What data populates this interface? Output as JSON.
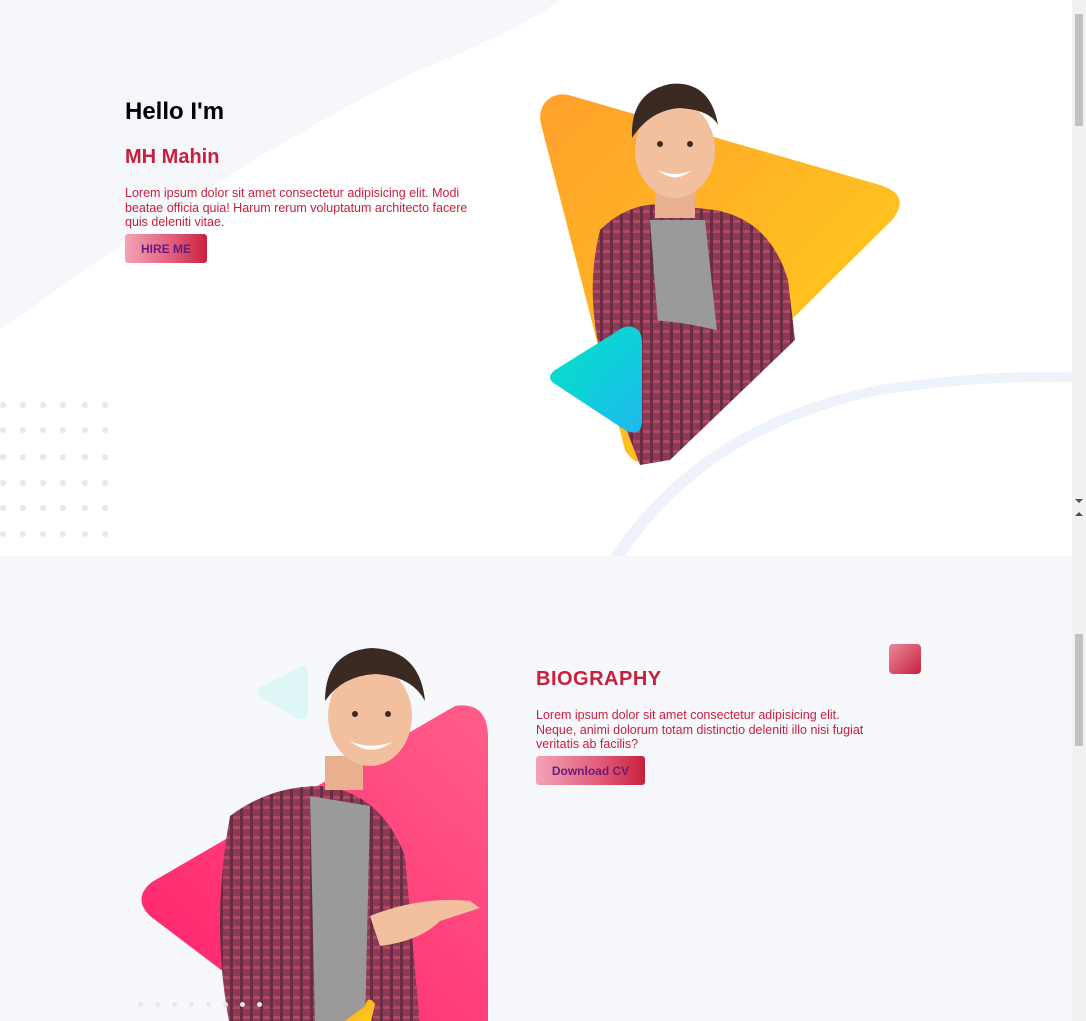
{
  "hero": {
    "greeting": "Hello I'm",
    "name": "MH Mahin",
    "description": "Lorem ipsum dolor sit amet consectetur adipisicing elit. Modi beatae officia quia! Harum rerum voluptatum architecto facere quis deleniti vitae.",
    "hire_button": "HIRE ME"
  },
  "biography": {
    "title": "BIOGRAPHY",
    "description": "Lorem ipsum dolor sit amet consectetur adipisicing elit. Neque, animi dolorum totam distinctio deleniti illo nisi fugiat veritatis ab facilis?",
    "download_button": "Download CV"
  },
  "colors": {
    "accent_red": "#c8203c",
    "button_text": "#6a1b7a",
    "gradient_orange_start": "#ffa02b",
    "gradient_orange_end": "#ffd21a",
    "gradient_teal": "#00e6c3",
    "gradient_pink": "#ff3c7e",
    "about_bg": "#f7f8fc"
  },
  "icons": {
    "hero_person_image": "person-arms-crossed-photo",
    "about_person_image": "person-pointing-photo",
    "decor_shapes": "triangle-shapes"
  }
}
